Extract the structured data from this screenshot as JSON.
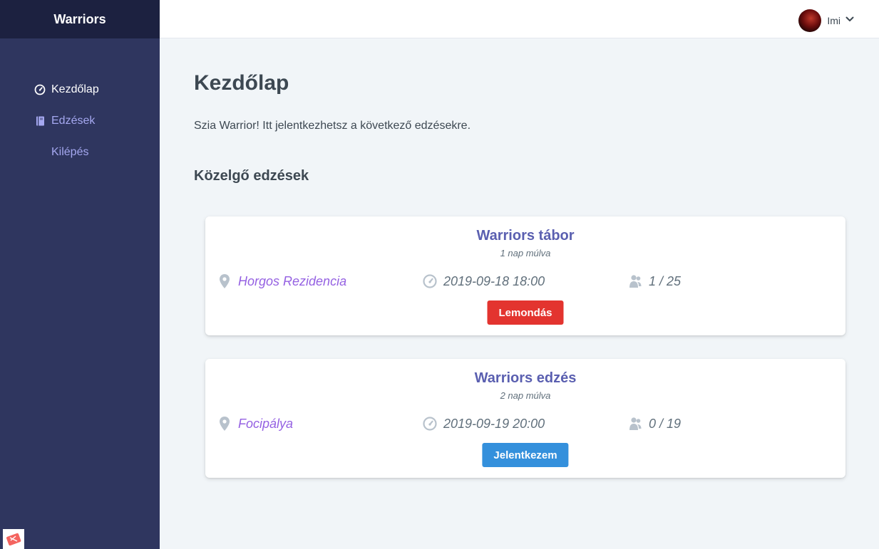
{
  "app": {
    "brand": "Warriors"
  },
  "sidebar": {
    "items": [
      {
        "label": "Kezdőlap",
        "icon": "dashboard-icon",
        "active": true
      },
      {
        "label": "Edzések",
        "icon": "book-icon",
        "active": false
      },
      {
        "label": "Kilépés",
        "icon": "",
        "active": false
      }
    ]
  },
  "header": {
    "user_name": "Imi",
    "avatar": "user-avatar"
  },
  "main": {
    "title": "Kezdőlap",
    "intro": "Szia Warrior! Itt jelentkezhetsz a következő edzésekre.",
    "section_title": "Közelgő edzések"
  },
  "trainings": [
    {
      "title": "Warriors tábor",
      "relative": "1 nap múlva",
      "location": "Horgos Rezidencia",
      "datetime": "2019-09-18 18:00",
      "participants": "1 / 25",
      "action": "Lemondás"
    },
    {
      "title": "Warriors edzés",
      "relative": "2 nap múlva",
      "location": "Focipálya",
      "datetime": "2019-09-19 20:00",
      "participants": "0 / 19",
      "action": "Jelentkezem"
    }
  ],
  "colors": {
    "sidebar_bg": "#2f365f",
    "brand_bg": "#1c2140",
    "accent": "#5a5fb0",
    "location": "#9561e2",
    "cancel": "#e3342f",
    "join": "#3490dc"
  }
}
